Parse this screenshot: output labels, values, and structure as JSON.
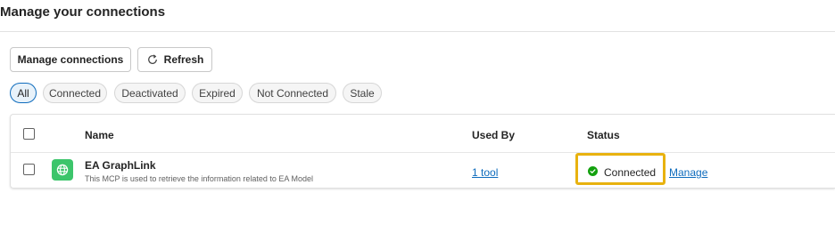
{
  "header": {
    "title": "Manage your connections"
  },
  "toolbar": {
    "manage_connections_label": "Manage connections",
    "refresh_label": "Refresh"
  },
  "filters": [
    {
      "label": "All",
      "active": true
    },
    {
      "label": "Connected",
      "active": false
    },
    {
      "label": "Deactivated",
      "active": false
    },
    {
      "label": "Expired",
      "active": false
    },
    {
      "label": "Not Connected",
      "active": false
    },
    {
      "label": "Stale",
      "active": false
    }
  ],
  "table": {
    "columns": {
      "name": "Name",
      "used_by": "Used By",
      "status": "Status"
    },
    "rows": [
      {
        "icon": "globe-network-icon",
        "name": "EA GraphLink",
        "description": "This MCP is used to retrieve the information related to EA Model",
        "used_by": "1 tool",
        "status": "Connected",
        "action": "Manage"
      }
    ]
  },
  "colors": {
    "accent": "#0f6cbd",
    "connected_green": "#13a10e",
    "app_icon_green": "#3cc56b",
    "highlight": "#e8b20f"
  }
}
